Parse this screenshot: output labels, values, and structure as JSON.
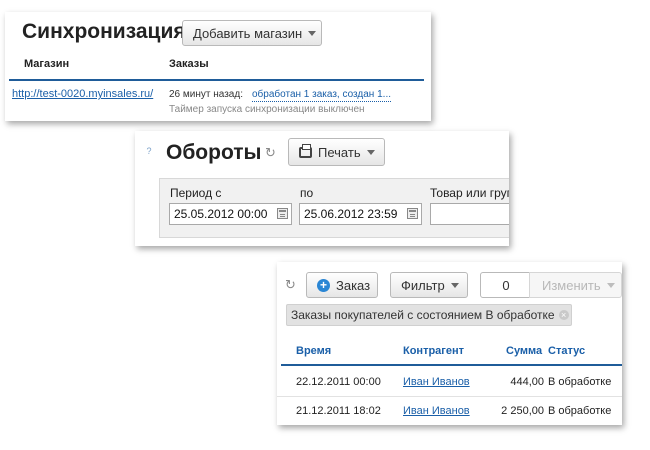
{
  "sync": {
    "title": "Синхронизация",
    "add_store_button": "Добавить магазин",
    "col_store": "Магазин",
    "col_orders": "Заказы",
    "store_link": "http://test-0020.myinsales.ru/",
    "time_ago": "26 минут назад:",
    "orders_link": "обработан 1 заказ, создан 1...",
    "timer_status": "Таймер запуска синхронизации выключен"
  },
  "turnover": {
    "help_icon": "?",
    "title": "Обороты",
    "print_button": "Печать",
    "period_from_label": "Период с",
    "period_to_label": "по",
    "product_label": "Товар или груп",
    "date_from": "25.05.2012 00:00",
    "date_to": "25.06.2012 23:59",
    "product_value": ""
  },
  "orders": {
    "add_order_button": "Заказ",
    "filter_button": "Фильтр",
    "count": "0",
    "change_button": "Изменить",
    "filter_tag": "Заказы покупателей с состоянием В обработке",
    "columns": {
      "time": "Время",
      "counterparty": "Контрагент",
      "sum": "Сумма",
      "status": "Статус"
    },
    "rows": [
      {
        "time": "22.12.2011 00:00",
        "counterparty": "Иван Иванов",
        "sum": "444,00",
        "status": "В обработке"
      },
      {
        "time": "21.12.2011 18:02",
        "counterparty": "Иван Иванов",
        "sum": "2 250,00",
        "status": "В обработке"
      }
    ]
  },
  "colors": {
    "accent_blue": "#1a5fa8",
    "header_rule": "#1f5c99",
    "add_icon": "#2a86d4"
  }
}
